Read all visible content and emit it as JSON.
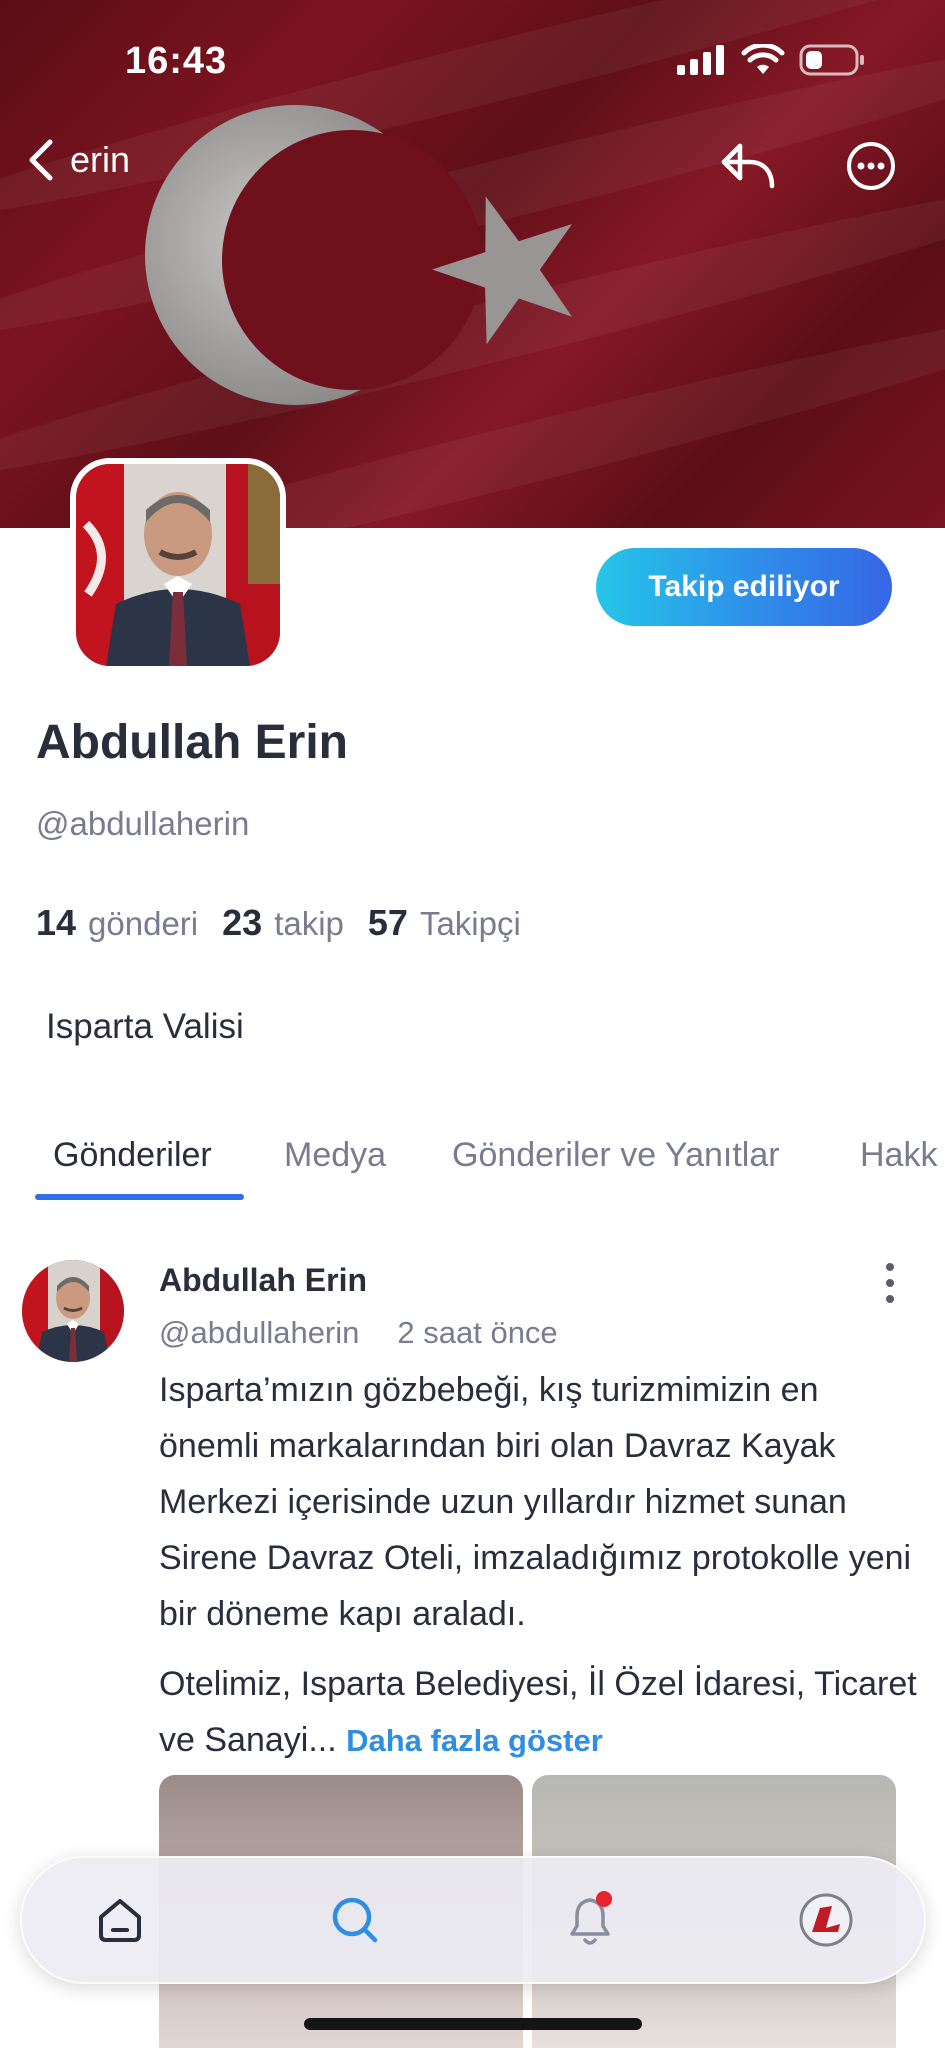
{
  "status_bar": {
    "time": "16:43",
    "battery_level": 0.3
  },
  "nav": {
    "back_label": "erin",
    "back_icon": "chevron-left-icon",
    "reply_icon": "reply-icon",
    "more_icon": "more-horizontal-icon"
  },
  "banner": {
    "description_icon": "turkish-flag-banner"
  },
  "profile": {
    "name": "Abdullah Erin",
    "handle": "@abdullaherin",
    "follow_button_label": "Takip ediliyor",
    "stats": [
      {
        "num": "14",
        "label": "gönderi"
      },
      {
        "num": "23",
        "label": "takip"
      },
      {
        "num": "57",
        "label": "Takipçi"
      }
    ],
    "bio": "Isparta Valisi"
  },
  "tabs": [
    {
      "label": "Gönderiler",
      "active": true
    },
    {
      "label": "Medya",
      "active": false
    },
    {
      "label": "Gönderiler ve Yanıtlar",
      "active": false
    },
    {
      "label": "Hakk",
      "active": false
    }
  ],
  "post": {
    "author": "Abdullah Erin",
    "handle": "@abdullaherin",
    "time": "2 saat önce",
    "paragraph_1": "Isparta’mızın gözbebeği, kış turizmimizin en önemli markalarından biri olan Davraz Kayak Merkezi içerisinde uzun yıllardır hizmet sunan Sirene Davraz Oteli, imzaladığımız protokolle yeni bir döneme kapı araladı.",
    "paragraph_2": "Otelimiz, Isparta Belediyesi, İl Özel İdaresi, Ticaret ve Sanayi...",
    "show_more": "Daha fazla göster"
  },
  "bottom_nav": {
    "items": [
      "home-icon",
      "search-icon",
      "bell-icon",
      "profile-avatar"
    ],
    "colors": {
      "active": "#2f8ee4",
      "inactive": "#2a2d3b",
      "badge": "#e8222e"
    }
  },
  "colors": {
    "accent": "#2f6fe6",
    "text": "#2a2d3b",
    "muted": "#797c8f",
    "link": "#2f8ee4"
  }
}
